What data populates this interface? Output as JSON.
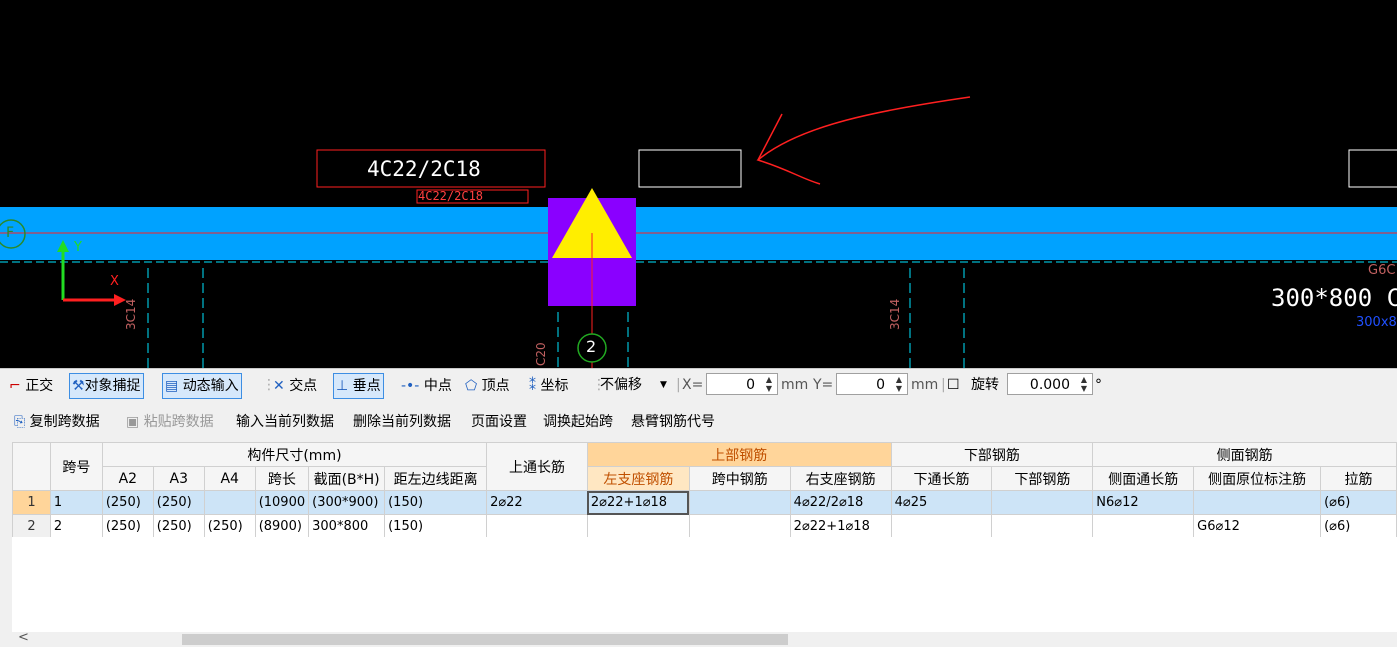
{
  "canvas": {
    "beam_label_primary": "4C22/2C18",
    "beam_label_secondary": "4C22/2C18",
    "axis_label": "F",
    "grid_label": "2",
    "rebar_left": "3C14",
    "rebar_mid": "3C14",
    "rebar_c20": "C20",
    "dim_top_right": "G6C",
    "section_label": "300*800",
    "section_suffix": "C",
    "section_small": "300x8",
    "axis_y": "Y",
    "axis_x": "X",
    "colors": {
      "beam": "#00a2ff",
      "column": "#8a00ff",
      "marker": "#ffee00",
      "annotation": "#ff2020",
      "cyan": "#00e5ff"
    }
  },
  "toolbar": {
    "ortho": "正交",
    "snap": "对象捕捉",
    "dyn_input": "动态输入",
    "intersection": "交点",
    "perpendicular": "垂点",
    "midpoint": "中点",
    "vertex": "顶点",
    "coord": "坐标",
    "offset_value": "不偏移",
    "x_label": "X=",
    "x_value": "0",
    "mm1": "mm",
    "y_label": "Y=",
    "y_value": "0",
    "mm2": "mm",
    "rotate": "旋转",
    "rotate_value": "0.000",
    "degree": "°"
  },
  "subtoolbar": {
    "copy": "复制跨数据",
    "paste": "粘贴跨数据",
    "input_col": "输入当前列数据",
    "delete_col": "删除当前列数据",
    "page_setup": "页面设置",
    "swap_span": "调换起始跨",
    "cantilever": "悬臂钢筋代号"
  },
  "grid": {
    "h_span": "跨号",
    "h_size": "构件尺寸(mm)",
    "h_top_through": "上通长筋",
    "h_top": "上部钢筋",
    "h_bottom": "下部钢筋",
    "h_side": "侧面钢筋",
    "h_a2": "A2",
    "h_a3": "A3",
    "h_a4": "A4",
    "h_span_len": "跨长",
    "h_section": "截面(B*H)",
    "h_dist": "距左边线距离",
    "h_left_seat": "左支座钢筋",
    "h_mid": "跨中钢筋",
    "h_right_seat": "右支座钢筋",
    "h_bottom_through": "下通长筋",
    "h_bottom_rebar": "下部钢筋",
    "h_side_through": "侧面通长筋",
    "h_side_orig": "侧面原位标注筋",
    "h_tie": "拉筋",
    "rows": [
      {
        "num": "1",
        "span": "1",
        "a2": "(250)",
        "a3": "(250)",
        "a4": "",
        "len": "(10900",
        "section": "(300*900)",
        "dist": "(150)",
        "top_through": "2⌀22",
        "left_seat": "2⌀22+1⌀18",
        "mid": "",
        "right_seat": "4⌀22/2⌀18",
        "bottom_through": "4⌀25",
        "bottom_rebar": "",
        "side_through": "N6⌀12",
        "side_orig": "",
        "tie": "(⌀6)"
      },
      {
        "num": "2",
        "span": "2",
        "a2": "(250)",
        "a3": "(250)",
        "a4": "(250)",
        "len": "(8900)",
        "section": "300*800",
        "dist": "(150)",
        "top_through": "",
        "left_seat": "",
        "mid": "",
        "right_seat": "2⌀22+1⌀18",
        "bottom_through": "",
        "bottom_rebar": "",
        "side_through": "",
        "side_orig": "G6⌀12",
        "tie": "(⌀6)"
      }
    ]
  },
  "scroll_left": "<"
}
